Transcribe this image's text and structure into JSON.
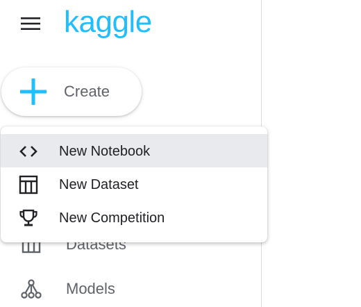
{
  "header": {
    "menu_icon": "hamburger-menu-icon",
    "logo_text": "kaggle"
  },
  "create_button": {
    "icon": "plus-icon",
    "label": "Create"
  },
  "create_menu": {
    "items": [
      {
        "icon": "code-brackets-icon",
        "label": "New Notebook",
        "highlighted": true
      },
      {
        "icon": "table-icon",
        "label": "New Dataset",
        "highlighted": false
      },
      {
        "icon": "trophy-icon",
        "label": "New Competition",
        "highlighted": false
      }
    ]
  },
  "sidebar": {
    "items": [
      {
        "icon": "dataset-table-icon",
        "label": "Datasets"
      },
      {
        "icon": "models-network-icon",
        "label": "Models"
      }
    ]
  },
  "colors": {
    "brand": "#20beff",
    "highlight_bg": "#e8eaed",
    "muted_text": "#5f6368"
  }
}
